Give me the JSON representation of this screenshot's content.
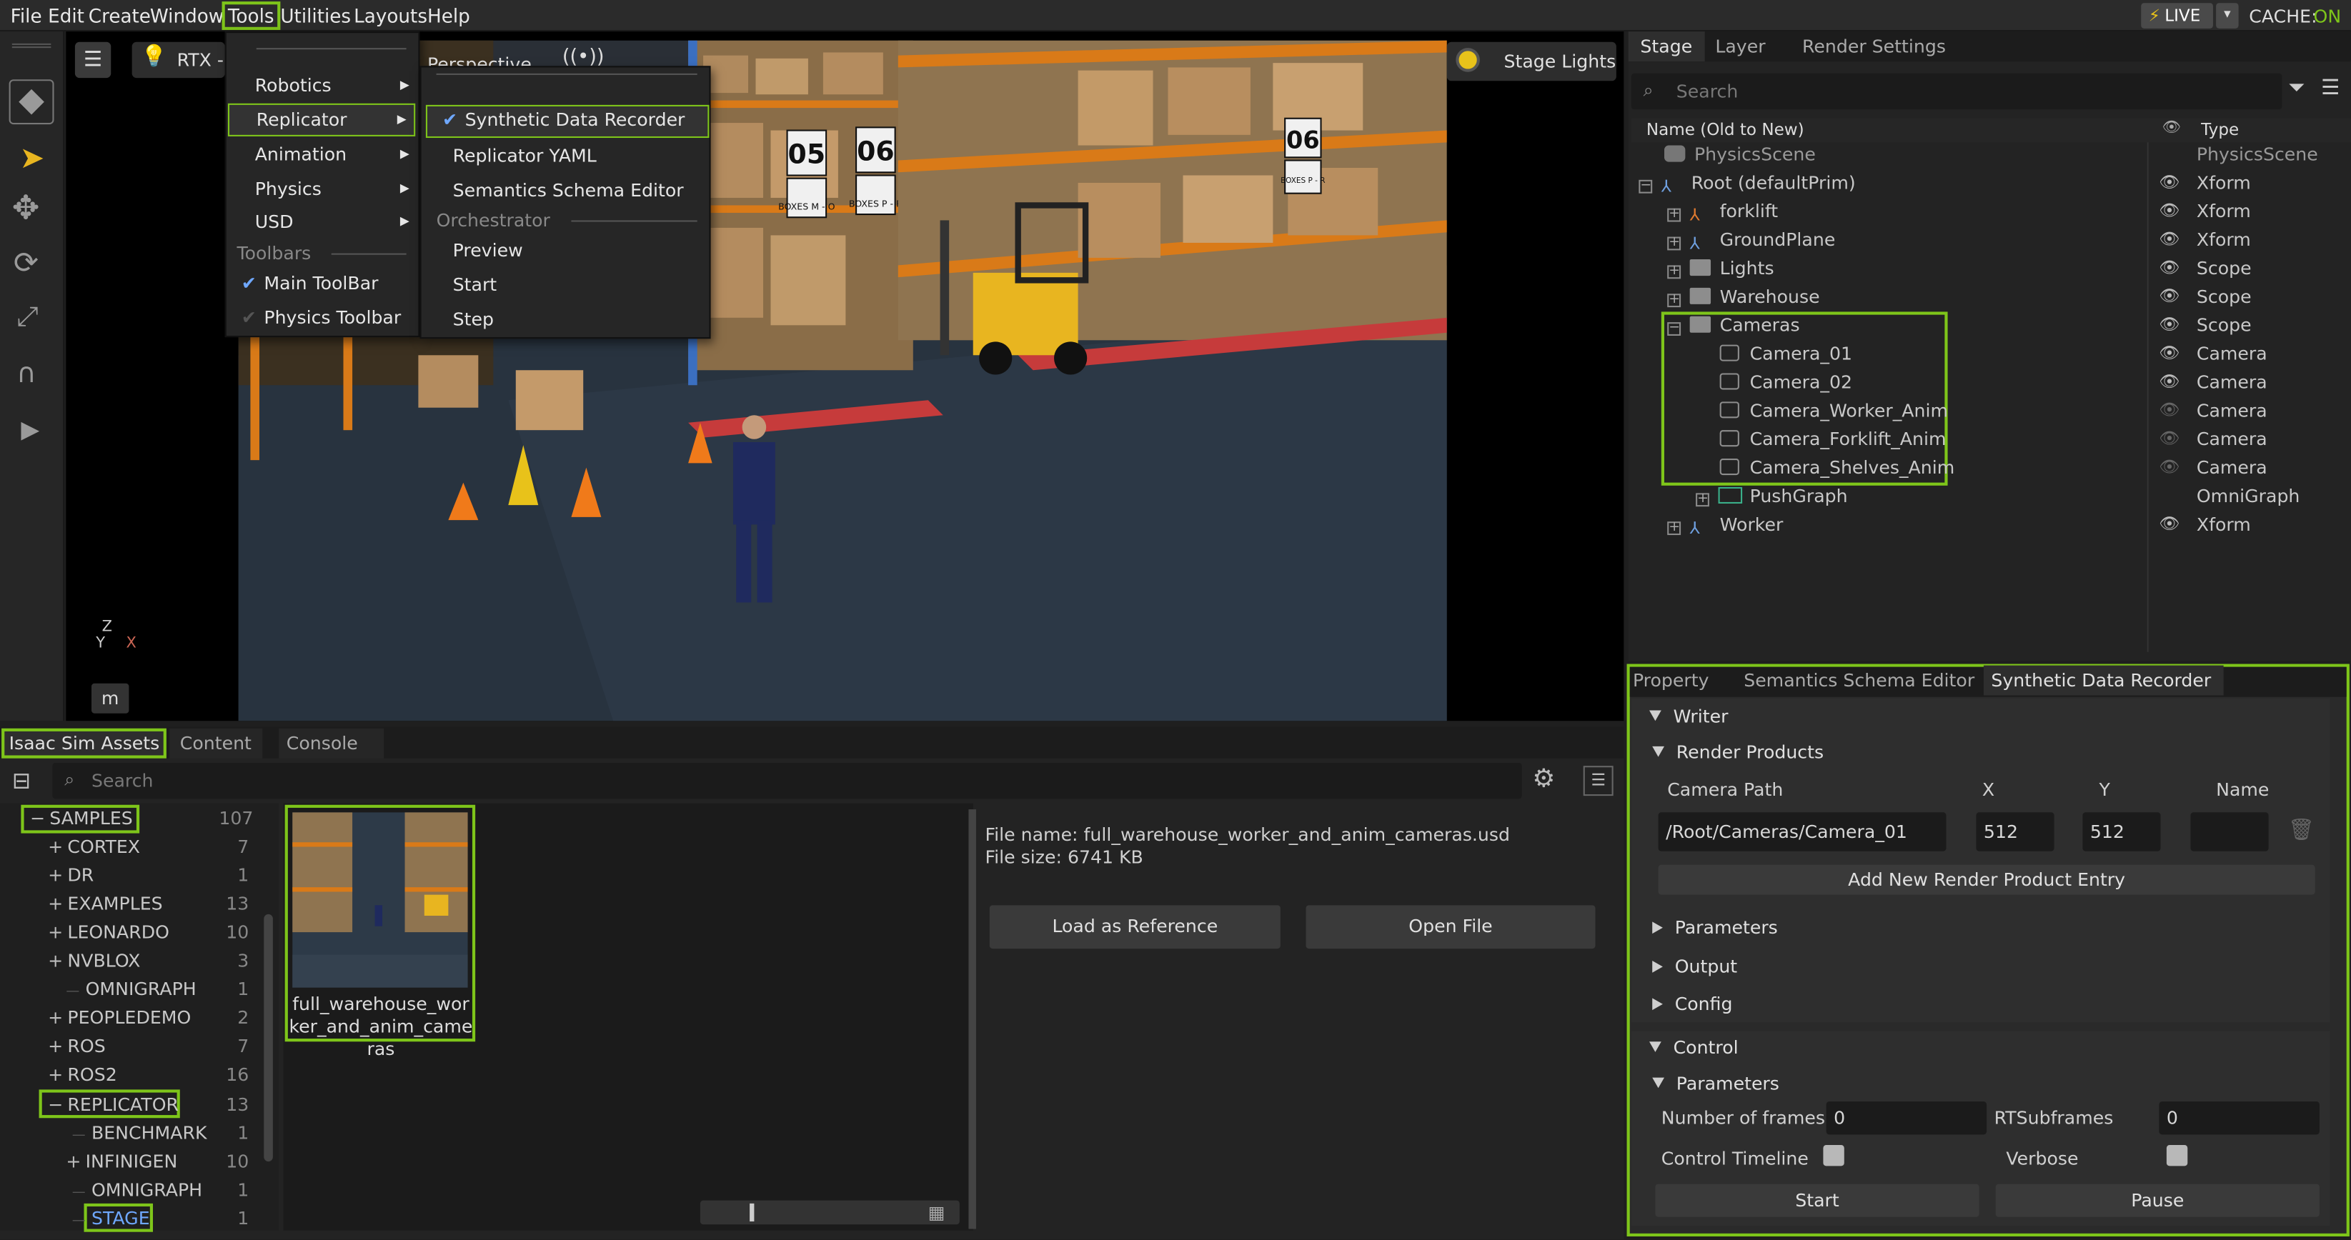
{
  "menubar": {
    "items": [
      "File",
      "Edit",
      "Create",
      "Window",
      "Tools",
      "Utilities",
      "Layouts",
      "Help"
    ],
    "live": "LIVE",
    "cache_label": "CACHE:",
    "cache_state": "ON"
  },
  "viewport": {
    "renderer": "RTX -",
    "camera": "Perspective",
    "stage_lights": "Stage Lights",
    "key_hint": "m",
    "axis_z": "Z",
    "axis_y": "Y",
    "axis_x": "X"
  },
  "scene": {
    "shelf_labels": [
      "05",
      "06",
      "06"
    ],
    "box_labels": [
      "BOXES M - O",
      "BOXES P - R",
      "BOXES P - R"
    ]
  },
  "tools_menu": {
    "items": [
      "Robotics",
      "Replicator",
      "Animation",
      "Physics",
      "USD"
    ],
    "toolbars_header": "Toolbars",
    "toolbars": [
      "Main ToolBar",
      "Physics Toolbar"
    ]
  },
  "replicator_menu": {
    "items": [
      "Synthetic Data Recorder",
      "Replicator YAML",
      "Semantics Schema Editor"
    ],
    "orchestrator_header": "Orchestrator",
    "orchestrator": [
      "Preview",
      "Start",
      "Step"
    ]
  },
  "stage": {
    "tabs": [
      "Stage",
      "Layer",
      "Render Settings"
    ],
    "search_placeholder": "Search",
    "col_name": "Name (Old to New)",
    "col_type": "Type",
    "rows": [
      {
        "name": "PhysicsScene",
        "type": "PhysicsScene"
      },
      {
        "name": "Root (defaultPrim)",
        "type": "Xform"
      },
      {
        "name": "forklift",
        "type": "Xform"
      },
      {
        "name": "GroundPlane",
        "type": "Xform"
      },
      {
        "name": "Lights",
        "type": "Scope"
      },
      {
        "name": "Warehouse",
        "type": "Scope"
      },
      {
        "name": "Cameras",
        "type": "Scope"
      },
      {
        "name": "Camera_01",
        "type": "Camera"
      },
      {
        "name": "Camera_02",
        "type": "Camera"
      },
      {
        "name": "Camera_Worker_Anim",
        "type": "Camera"
      },
      {
        "name": "Camera_Forklift_Anim",
        "type": "Camera"
      },
      {
        "name": "Camera_Shelves_Anim",
        "type": "Camera"
      },
      {
        "name": "PushGraph",
        "type": "OmniGraph"
      },
      {
        "name": "Worker",
        "type": "Xform"
      }
    ]
  },
  "props": {
    "tabs": [
      "Property",
      "Semantics Schema Editor",
      "Synthetic Data Recorder"
    ],
    "writer": "Writer",
    "render_products": "Render Products",
    "col_camera": "Camera Path",
    "col_x": "X",
    "col_y": "Y",
    "col_name": "Name",
    "camera_path": "/Root/Cameras/Camera_01",
    "x": "512",
    "y": "512",
    "name": "",
    "add_entry": "Add New Render Product Entry",
    "parameters": "Parameters",
    "output": "Output",
    "config": "Config",
    "control": "Control",
    "control_params": "Parameters",
    "num_frames_label": "Number of frames",
    "num_frames": "0",
    "rt_label": "RTSubframes",
    "rt": "0",
    "timeline_label": "Control Timeline",
    "verbose_label": "Verbose",
    "start": "Start",
    "pause": "Pause"
  },
  "assets": {
    "tabs": [
      "Isaac Sim Assets",
      "Content",
      "Console"
    ],
    "search_placeholder": "Search",
    "tree": [
      {
        "name": "SAMPLES",
        "count": "107",
        "sign": "−"
      },
      {
        "name": "CORTEX",
        "count": "7",
        "sign": "+"
      },
      {
        "name": "DR",
        "count": "1",
        "sign": "+"
      },
      {
        "name": "EXAMPLES",
        "count": "13",
        "sign": "+"
      },
      {
        "name": "LEONARDO",
        "count": "10",
        "sign": "+"
      },
      {
        "name": "NVBLOX",
        "count": "3",
        "sign": "+"
      },
      {
        "name": "OMNIGRAPH",
        "count": "1",
        "sign": ""
      },
      {
        "name": "PEOPLEDEMO",
        "count": "2",
        "sign": "+"
      },
      {
        "name": "ROS",
        "count": "7",
        "sign": "+"
      },
      {
        "name": "ROS2",
        "count": "16",
        "sign": "+"
      },
      {
        "name": "REPLICATOR",
        "count": "13",
        "sign": "−"
      },
      {
        "name": "BENCHMARK",
        "count": "1",
        "sign": ""
      },
      {
        "name": "INFINIGEN",
        "count": "10",
        "sign": "+"
      },
      {
        "name": "OMNIGRAPH",
        "count": "1",
        "sign": ""
      },
      {
        "name": "STAGE",
        "count": "1",
        "sign": ""
      }
    ],
    "thumb_label": "full_warehouse_worker_and_anim_cameras",
    "file_name_label": "File name: full_warehouse_worker_and_anim_cameras.usd",
    "file_size_label": "File size: 6741 KB",
    "load_ref": "Load as Reference",
    "open_file": "Open File"
  },
  "colors": {
    "accent": "#7ec51a",
    "live": "#e8c21a",
    "cache_on": "#7ec51a"
  }
}
